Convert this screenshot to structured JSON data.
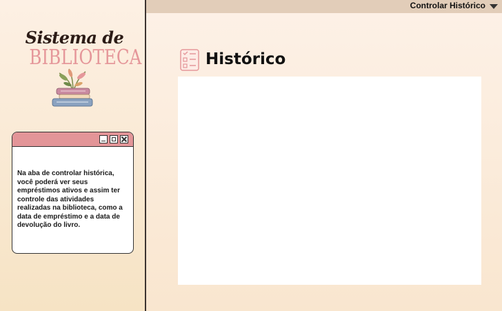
{
  "topbar": {
    "menu_label": "Controlar Histórico"
  },
  "logo": {
    "line1": "Sistema de",
    "line2": "BIBLIOTECA"
  },
  "info_window": {
    "text": "Na aba de controlar histórica, você poderá ver seus empréstimos ativos e assim ter controle das atividades realizadas na biblioteca, como a data de empréstimo e a data de devolução do livro."
  },
  "main": {
    "title": "Histórico"
  },
  "colors": {
    "accent_pink": "#e39598",
    "topbar": "#e2cdb9",
    "logo_pink": "#e5979a"
  }
}
